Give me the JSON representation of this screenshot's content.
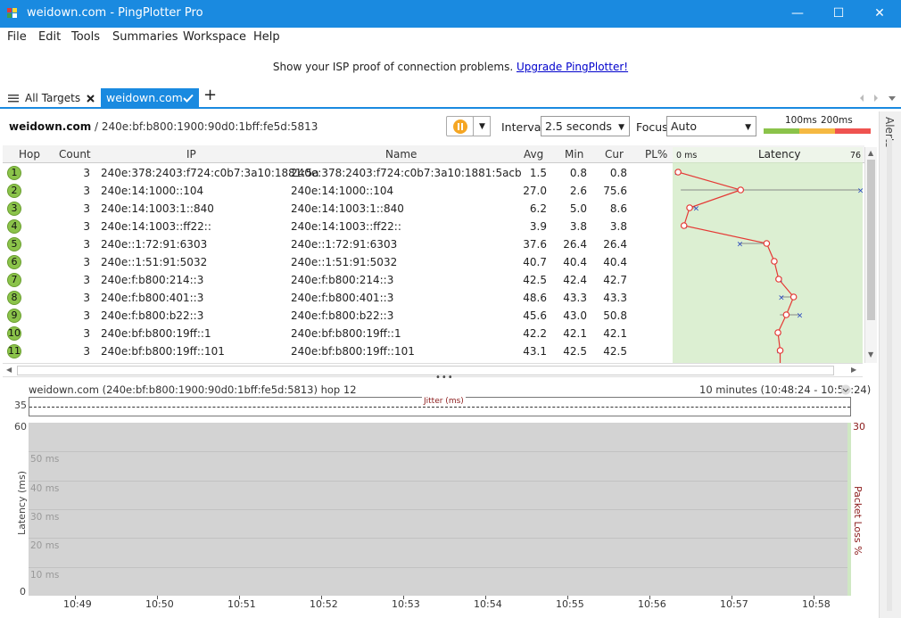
{
  "window": {
    "title": "weidown.com - PingPlotter Pro",
    "minimize": "—",
    "maximize": "☐",
    "close": "✕"
  },
  "menu": [
    "File",
    "Edit",
    "Tools",
    "Summaries",
    "Workspace",
    "Help"
  ],
  "promo": {
    "text": "Show your ISP proof of connection problems.",
    "link": "Upgrade PingPlotter!"
  },
  "tabs": {
    "all_targets": "All Targets",
    "active": "weidown.com",
    "add": "+"
  },
  "toolbar": {
    "host": "weidown.com",
    "separator": " / ",
    "ip": "240e:bf:b800:1900:90d0:1bff:fe5d:5813",
    "interval_label": "Interval",
    "interval_value": "2.5 seconds",
    "focus_label": "Focus",
    "focus_value": "Auto",
    "scale_100": "100ms",
    "scale_200": "200ms"
  },
  "columns": [
    "Hop",
    "Count",
    "IP",
    "Name",
    "Avg",
    "Min",
    "Cur",
    "PL%",
    "Latency"
  ],
  "latency_axis": {
    "min_label": "0 ms",
    "max_label": "76"
  },
  "rows": [
    {
      "hop": "1",
      "count": "3",
      "ip": "240e:378:2403:f724:c0b7:3a10:1881:5a",
      "name": "240e:378:2403:f724:c0b7:3a10:1881:5acb",
      "avg": "1.5",
      "min": "0.8",
      "cur": "0.8"
    },
    {
      "hop": "2",
      "count": "3",
      "ip": "240e:14:1000::104",
      "name": "240e:14:1000::104",
      "avg": "27.0",
      "min": "2.6",
      "cur": "75.6"
    },
    {
      "hop": "3",
      "count": "3",
      "ip": "240e:14:1003:1::840",
      "name": "240e:14:1003:1::840",
      "avg": "6.2",
      "min": "5.0",
      "cur": "8.6"
    },
    {
      "hop": "4",
      "count": "3",
      "ip": "240e:14:1003::ff22::",
      "name": "240e:14:1003::ff22::",
      "avg": "3.9",
      "min": "3.8",
      "cur": "3.8"
    },
    {
      "hop": "5",
      "count": "3",
      "ip": "240e::1:72:91:6303",
      "name": "240e::1:72:91:6303",
      "avg": "37.6",
      "min": "26.4",
      "cur": "26.4"
    },
    {
      "hop": "6",
      "count": "3",
      "ip": "240e::1:51:91:5032",
      "name": "240e::1:51:91:5032",
      "avg": "40.7",
      "min": "40.4",
      "cur": "40.4"
    },
    {
      "hop": "7",
      "count": "3",
      "ip": "240e:f:b800:214::3",
      "name": "240e:f:b800:214::3",
      "avg": "42.5",
      "min": "42.4",
      "cur": "42.7"
    },
    {
      "hop": "8",
      "count": "3",
      "ip": "240e:f:b800:401::3",
      "name": "240e:f:b800:401::3",
      "avg": "48.6",
      "min": "43.3",
      "cur": "43.3"
    },
    {
      "hop": "9",
      "count": "3",
      "ip": "240e:f:b800:b22::3",
      "name": "240e:f:b800:b22::3",
      "avg": "45.6",
      "min": "43.0",
      "cur": "50.8"
    },
    {
      "hop": "10",
      "count": "3",
      "ip": "240e:bf:b800:19ff::1",
      "name": "240e:bf:b800:19ff::1",
      "avg": "42.2",
      "min": "42.1",
      "cur": "42.1"
    },
    {
      "hop": "11",
      "count": "3",
      "ip": "240e:bf:b800:19ff::101",
      "name": "240e:bf:b800:19ff::101",
      "avg": "43.1",
      "min": "42.5",
      "cur": "42.5"
    }
  ],
  "bottom": {
    "title": "weidown.com (240e:bf:b800:1900:90d0:1bff:fe5d:5813) hop 12",
    "range": "10 minutes (10:48:24 - 10:58:24)",
    "jitter_label": "Jitter (ms)",
    "jitter_max": "35",
    "y_max": "60",
    "y_min": "0",
    "y_label": "Latency (ms)",
    "pl_max": "30",
    "pl_label": "Packet Loss %",
    "grid_labels": [
      "50 ms",
      "40 ms",
      "30 ms",
      "20 ms",
      "10 ms"
    ],
    "x_ticks": [
      "10:49",
      "10:50",
      "10:51",
      "10:52",
      "10:53",
      "10:54",
      "10:55",
      "10:56",
      "10:57",
      "10:58"
    ]
  },
  "side": {
    "alerts": "Alerts"
  }
}
